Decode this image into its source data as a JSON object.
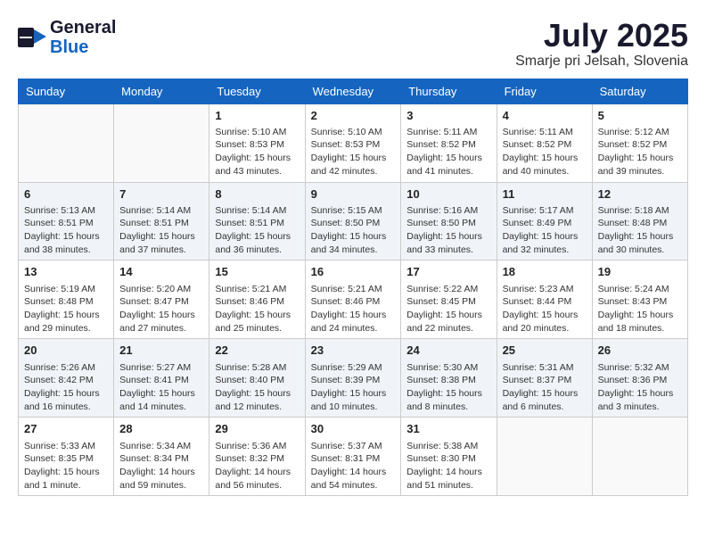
{
  "header": {
    "logo_general": "General",
    "logo_blue": "Blue",
    "month": "July 2025",
    "location": "Smarje pri Jelsah, Slovenia"
  },
  "days_of_week": [
    "Sunday",
    "Monday",
    "Tuesday",
    "Wednesday",
    "Thursday",
    "Friday",
    "Saturday"
  ],
  "weeks": [
    {
      "cells": [
        {
          "day": "",
          "empty": true
        },
        {
          "day": "",
          "empty": true
        },
        {
          "day": "1",
          "sunrise": "Sunrise: 5:10 AM",
          "sunset": "Sunset: 8:53 PM",
          "daylight": "Daylight: 15 hours and 43 minutes."
        },
        {
          "day": "2",
          "sunrise": "Sunrise: 5:10 AM",
          "sunset": "Sunset: 8:53 PM",
          "daylight": "Daylight: 15 hours and 42 minutes."
        },
        {
          "day": "3",
          "sunrise": "Sunrise: 5:11 AM",
          "sunset": "Sunset: 8:52 PM",
          "daylight": "Daylight: 15 hours and 41 minutes."
        },
        {
          "day": "4",
          "sunrise": "Sunrise: 5:11 AM",
          "sunset": "Sunset: 8:52 PM",
          "daylight": "Daylight: 15 hours and 40 minutes."
        },
        {
          "day": "5",
          "sunrise": "Sunrise: 5:12 AM",
          "sunset": "Sunset: 8:52 PM",
          "daylight": "Daylight: 15 hours and 39 minutes."
        }
      ]
    },
    {
      "cells": [
        {
          "day": "6",
          "sunrise": "Sunrise: 5:13 AM",
          "sunset": "Sunset: 8:51 PM",
          "daylight": "Daylight: 15 hours and 38 minutes."
        },
        {
          "day": "7",
          "sunrise": "Sunrise: 5:14 AM",
          "sunset": "Sunset: 8:51 PM",
          "daylight": "Daylight: 15 hours and 37 minutes."
        },
        {
          "day": "8",
          "sunrise": "Sunrise: 5:14 AM",
          "sunset": "Sunset: 8:51 PM",
          "daylight": "Daylight: 15 hours and 36 minutes."
        },
        {
          "day": "9",
          "sunrise": "Sunrise: 5:15 AM",
          "sunset": "Sunset: 8:50 PM",
          "daylight": "Daylight: 15 hours and 34 minutes."
        },
        {
          "day": "10",
          "sunrise": "Sunrise: 5:16 AM",
          "sunset": "Sunset: 8:50 PM",
          "daylight": "Daylight: 15 hours and 33 minutes."
        },
        {
          "day": "11",
          "sunrise": "Sunrise: 5:17 AM",
          "sunset": "Sunset: 8:49 PM",
          "daylight": "Daylight: 15 hours and 32 minutes."
        },
        {
          "day": "12",
          "sunrise": "Sunrise: 5:18 AM",
          "sunset": "Sunset: 8:48 PM",
          "daylight": "Daylight: 15 hours and 30 minutes."
        }
      ]
    },
    {
      "cells": [
        {
          "day": "13",
          "sunrise": "Sunrise: 5:19 AM",
          "sunset": "Sunset: 8:48 PM",
          "daylight": "Daylight: 15 hours and 29 minutes."
        },
        {
          "day": "14",
          "sunrise": "Sunrise: 5:20 AM",
          "sunset": "Sunset: 8:47 PM",
          "daylight": "Daylight: 15 hours and 27 minutes."
        },
        {
          "day": "15",
          "sunrise": "Sunrise: 5:21 AM",
          "sunset": "Sunset: 8:46 PM",
          "daylight": "Daylight: 15 hours and 25 minutes."
        },
        {
          "day": "16",
          "sunrise": "Sunrise: 5:21 AM",
          "sunset": "Sunset: 8:46 PM",
          "daylight": "Daylight: 15 hours and 24 minutes."
        },
        {
          "day": "17",
          "sunrise": "Sunrise: 5:22 AM",
          "sunset": "Sunset: 8:45 PM",
          "daylight": "Daylight: 15 hours and 22 minutes."
        },
        {
          "day": "18",
          "sunrise": "Sunrise: 5:23 AM",
          "sunset": "Sunset: 8:44 PM",
          "daylight": "Daylight: 15 hours and 20 minutes."
        },
        {
          "day": "19",
          "sunrise": "Sunrise: 5:24 AM",
          "sunset": "Sunset: 8:43 PM",
          "daylight": "Daylight: 15 hours and 18 minutes."
        }
      ]
    },
    {
      "cells": [
        {
          "day": "20",
          "sunrise": "Sunrise: 5:26 AM",
          "sunset": "Sunset: 8:42 PM",
          "daylight": "Daylight: 15 hours and 16 minutes."
        },
        {
          "day": "21",
          "sunrise": "Sunrise: 5:27 AM",
          "sunset": "Sunset: 8:41 PM",
          "daylight": "Daylight: 15 hours and 14 minutes."
        },
        {
          "day": "22",
          "sunrise": "Sunrise: 5:28 AM",
          "sunset": "Sunset: 8:40 PM",
          "daylight": "Daylight: 15 hours and 12 minutes."
        },
        {
          "day": "23",
          "sunrise": "Sunrise: 5:29 AM",
          "sunset": "Sunset: 8:39 PM",
          "daylight": "Daylight: 15 hours and 10 minutes."
        },
        {
          "day": "24",
          "sunrise": "Sunrise: 5:30 AM",
          "sunset": "Sunset: 8:38 PM",
          "daylight": "Daylight: 15 hours and 8 minutes."
        },
        {
          "day": "25",
          "sunrise": "Sunrise: 5:31 AM",
          "sunset": "Sunset: 8:37 PM",
          "daylight": "Daylight: 15 hours and 6 minutes."
        },
        {
          "day": "26",
          "sunrise": "Sunrise: 5:32 AM",
          "sunset": "Sunset: 8:36 PM",
          "daylight": "Daylight: 15 hours and 3 minutes."
        }
      ]
    },
    {
      "cells": [
        {
          "day": "27",
          "sunrise": "Sunrise: 5:33 AM",
          "sunset": "Sunset: 8:35 PM",
          "daylight": "Daylight: 15 hours and 1 minute."
        },
        {
          "day": "28",
          "sunrise": "Sunrise: 5:34 AM",
          "sunset": "Sunset: 8:34 PM",
          "daylight": "Daylight: 14 hours and 59 minutes."
        },
        {
          "day": "29",
          "sunrise": "Sunrise: 5:36 AM",
          "sunset": "Sunset: 8:32 PM",
          "daylight": "Daylight: 14 hours and 56 minutes."
        },
        {
          "day": "30",
          "sunrise": "Sunrise: 5:37 AM",
          "sunset": "Sunset: 8:31 PM",
          "daylight": "Daylight: 14 hours and 54 minutes."
        },
        {
          "day": "31",
          "sunrise": "Sunrise: 5:38 AM",
          "sunset": "Sunset: 8:30 PM",
          "daylight": "Daylight: 14 hours and 51 minutes."
        },
        {
          "day": "",
          "empty": true
        },
        {
          "day": "",
          "empty": true
        }
      ]
    }
  ]
}
